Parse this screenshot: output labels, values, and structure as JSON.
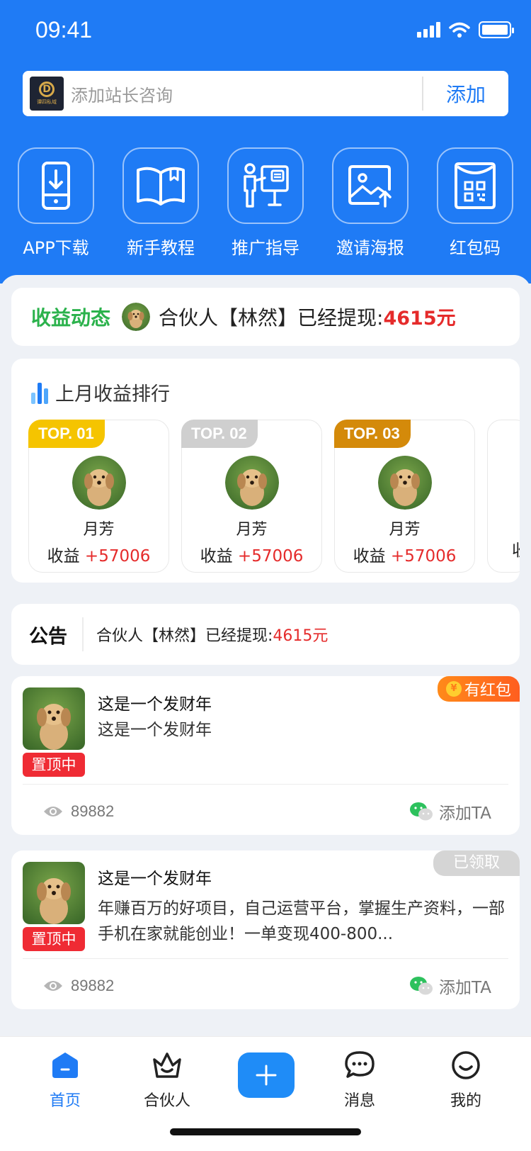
{
  "status_bar": {
    "time": "09:41"
  },
  "search": {
    "placeholder": "添加站长咨询",
    "add_label": "添加",
    "logo_text": "谭四私域",
    "logo_mark": "D"
  },
  "quick_menu": [
    {
      "label": "APP下载",
      "icon": "phone-download-icon"
    },
    {
      "label": "新手教程",
      "icon": "book-icon"
    },
    {
      "label": "推广指导",
      "icon": "presenter-icon"
    },
    {
      "label": "邀请海报",
      "icon": "image-upload-icon"
    },
    {
      "label": "红包码",
      "icon": "qr-envelope-icon"
    }
  ],
  "earn_feed": {
    "title": "收益动态",
    "text": "合伙人【林然】已经提现:",
    "amount": "4615元"
  },
  "ranking": {
    "title": "上月收益排行",
    "earn_prefix": "收益 ",
    "items": [
      {
        "badge": "TOP. 01",
        "name": "月芳",
        "amount": "+57006",
        "badge_color": "#f5c400"
      },
      {
        "badge": "TOP. 02",
        "name": "月芳",
        "amount": "+57006",
        "badge_color": "#cfcfcf"
      },
      {
        "badge": "TOP. 03",
        "name": "月芳",
        "amount": "+57006",
        "badge_color": "#d48a0a"
      }
    ],
    "partial_label": "收"
  },
  "notice": {
    "label": "公告",
    "text": "合伙人【林然】已经提现:",
    "amount": "4615元"
  },
  "posts": [
    {
      "title": "这是一个发财年",
      "body": "这是一个发财年",
      "pin": "置顶中",
      "tag": "有红包",
      "tag_coin": "¥",
      "views": "89882",
      "add_label": "添加TA"
    },
    {
      "title": "这是一个发财年",
      "body": "年赚百万的好项目，自己运营平台，掌握生产资料，一部手机在家就能创业！一单变现400-800...",
      "pin": "置顶中",
      "tag": "已领取",
      "views": "89882",
      "add_label": "添加TA"
    }
  ],
  "tabs": [
    {
      "label": "首页",
      "icon": "home-icon",
      "active": true
    },
    {
      "label": "合伙人",
      "icon": "crown-icon"
    },
    {
      "label": "",
      "icon": "plus-icon"
    },
    {
      "label": "消息",
      "icon": "chat-icon"
    },
    {
      "label": "我的",
      "icon": "smile-icon"
    }
  ],
  "colors": {
    "primary": "#1f7bf5",
    "green": "#2bb24c",
    "red": "#e52b2b",
    "tag_orange": "#ff6f1f"
  }
}
